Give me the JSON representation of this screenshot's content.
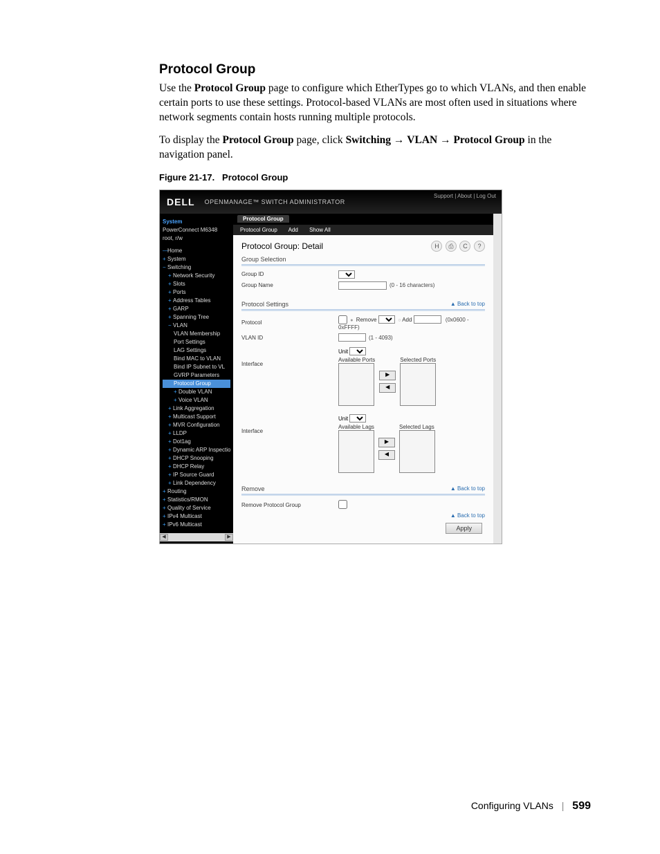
{
  "heading": "Protocol Group",
  "para1_a": "Use the ",
  "para1_b": "Protocol Group",
  "para1_c": " page to configure which EtherTypes go to which VLANs, and then enable certain ports to use these settings. Protocol-based VLANs are most often used in situations where network segments contain hosts running multiple protocols.",
  "para2_a": "To display the ",
  "para2_b": "Protocol Group",
  "para2_c": " page, click ",
  "para2_d": "Switching",
  "para2_e": " → ",
  "para2_f": "VLAN",
  "para2_g": " → ",
  "para2_h": "Protocol Group",
  "para2_i": " in the navigation panel.",
  "figure_caption_a": "Figure 21-17.",
  "figure_caption_b": "Protocol Group",
  "shot": {
    "logo": "DELL",
    "app_title": "OPENMANAGE™ SWITCH ADMINISTRATOR",
    "top_links": "Support | About | Log Out",
    "sidebar_head": "System",
    "sidebar_sub1": "PowerConnect M6348",
    "sidebar_sub2": "root, r/w",
    "tree": [
      "Home",
      "System",
      "Switching",
      "Network Security",
      "Slots",
      "Ports",
      "Address Tables",
      "GARP",
      "Spanning Tree",
      "VLAN",
      "VLAN Membership",
      "Port Settings",
      "LAG Settings",
      "Bind MAC to VLAN",
      "Bind IP Subnet to VL",
      "GVRP Parameters",
      "Protocol Group",
      "Double VLAN",
      "Voice VLAN",
      "Link Aggregation",
      "Multicast Support",
      "MVR Configuration",
      "LLDP",
      "Dot1ag",
      "Dynamic ARP Inspection",
      "DHCP Snooping",
      "DHCP Relay",
      "IP Source Guard",
      "Link Dependency",
      "Routing",
      "Statistics/RMON",
      "Quality of Service",
      "IPv4 Multicast",
      "IPv6 Multicast"
    ],
    "tree_selected_index": 16,
    "tab": "Protocol Group",
    "subtabs": [
      "Protocol Group",
      "Add",
      "Show All"
    ],
    "panel_title": "Protocol Group: Detail",
    "icons": [
      "H",
      "⎙",
      "C",
      "?"
    ],
    "section_group_selection": "Group Selection",
    "lbl_group_id": "Group ID",
    "lbl_group_name": "Group Name",
    "hint_group_name": "(0 - 16 characters)",
    "section_protocol_settings": "Protocol Settings",
    "back_to_top": "▲ Back to top",
    "lbl_protocol": "Protocol",
    "proto_remove": "Remove",
    "proto_add": "Add",
    "proto_add_hint": "(0x0600 - 0xFFFF)",
    "lbl_vlan_id": "VLAN ID",
    "hint_vlan_id": "(1 - 4093)",
    "lbl_interface": "Interface",
    "unit_lbl": "Unit",
    "avail_ports": "Available Ports",
    "sel_ports": "Selected Ports",
    "avail_lags": "Available Lags",
    "sel_lags": "Selected Lags",
    "mover_right": "▶",
    "mover_left": "◀",
    "section_remove": "Remove",
    "lbl_remove_pg": "Remove Protocol Group",
    "apply": "Apply"
  },
  "footer_text": "Configuring VLANs",
  "footer_page": "599"
}
